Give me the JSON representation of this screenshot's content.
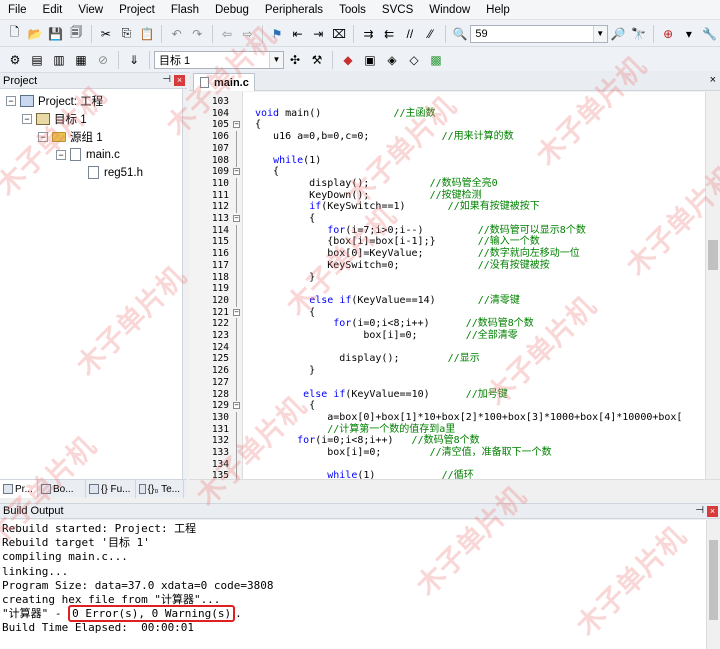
{
  "menu": [
    "File",
    "Edit",
    "View",
    "Project",
    "Flash",
    "Debug",
    "Peripherals",
    "Tools",
    "SVCS",
    "Window",
    "Help"
  ],
  "toolbar": {
    "find_value": "59",
    "target_select": "目标 1",
    "icons": [
      "new-file-icon",
      "open-icon",
      "save-icon",
      "save-all-icon",
      "cut-icon",
      "copy-icon",
      "paste-icon",
      "undo-icon",
      "redo-icon",
      "back-icon",
      "forward-icon",
      "bookmark-icon",
      "find-in-files-icon",
      "indent-icon",
      "unindent-icon",
      "comment-icon",
      "uncomment-icon",
      "find-icon",
      "debug-icon",
      "settings-icon"
    ]
  },
  "project_panel": {
    "title": "Project",
    "tree": [
      {
        "label": "Project: 工程",
        "level": 0,
        "kind": "project",
        "toggle": "−"
      },
      {
        "label": "目标 1",
        "level": 1,
        "kind": "target",
        "toggle": "−"
      },
      {
        "label": "源组 1",
        "level": 2,
        "kind": "folder",
        "toggle": "−"
      },
      {
        "label": "main.c",
        "level": 3,
        "kind": "file",
        "toggle": "−"
      },
      {
        "label": "reg51.h",
        "level": 4,
        "kind": "file",
        "toggle": ""
      }
    ],
    "tabs": [
      "Pr...",
      "Bo...",
      "{} Fu...",
      "{}₀ Te..."
    ]
  },
  "editor": {
    "tab_label": "main.c",
    "lines": [
      {
        "n": "103",
        "t": "",
        "fold": ""
      },
      {
        "n": "104",
        "t": "void main()            //主函数",
        "fold": ""
      },
      {
        "n": "105",
        "t": "{",
        "fold": "−"
      },
      {
        "n": "106",
        "t": "   u16 a=0,b=0,c=0;            //用来计算的数",
        "fold": ""
      },
      {
        "n": "107",
        "t": "",
        "fold": ""
      },
      {
        "n": "108",
        "t": "   while(1)",
        "fold": ""
      },
      {
        "n": "109",
        "t": "   {",
        "fold": "−"
      },
      {
        "n": "110",
        "t": "         display();          //数码管全亮0",
        "fold": ""
      },
      {
        "n": "111",
        "t": "         KeyDown();          //按键检测",
        "fold": ""
      },
      {
        "n": "112",
        "t": "         if(KeySwitch==1)       //如果有按键被按下",
        "fold": ""
      },
      {
        "n": "113",
        "t": "         {",
        "fold": "−"
      },
      {
        "n": "114",
        "t": "            for(i=7;i>0;i--)         //数码管可以显示8个数",
        "fold": ""
      },
      {
        "n": "115",
        "t": "            {box[i]=box[i-1];}       //输入一个数",
        "fold": ""
      },
      {
        "n": "116",
        "t": "            box[0]=KeyValue;         //数字就向左移动一位",
        "fold": ""
      },
      {
        "n": "117",
        "t": "            KeySwitch=0;             //没有按键被按",
        "fold": ""
      },
      {
        "n": "118",
        "t": "         }",
        "fold": ""
      },
      {
        "n": "119",
        "t": "",
        "fold": ""
      },
      {
        "n": "120",
        "t": "         else if(KeyValue==14)       //清零键",
        "fold": ""
      },
      {
        "n": "121",
        "t": "         {",
        "fold": "−"
      },
      {
        "n": "122",
        "t": "             for(i=0;i<8;i++)      //数码管8个数",
        "fold": ""
      },
      {
        "n": "123",
        "t": "                  box[i]=0;        //全部清零",
        "fold": ""
      },
      {
        "n": "124",
        "t": "",
        "fold": ""
      },
      {
        "n": "125",
        "t": "              display();        //显示",
        "fold": ""
      },
      {
        "n": "126",
        "t": "         }",
        "fold": ""
      },
      {
        "n": "127",
        "t": "",
        "fold": ""
      },
      {
        "n": "128",
        "t": "        else if(KeyValue==10)      //加号键",
        "fold": ""
      },
      {
        "n": "129",
        "t": "         {",
        "fold": "−"
      },
      {
        "n": "130",
        "t": "            a=box[0]+box[1]*10+box[2]*100+box[3]*1000+box[4]*10000+box[",
        "fold": ""
      },
      {
        "n": "131",
        "t": "            //计算第一个数的值存到a里",
        "fold": ""
      },
      {
        "n": "132",
        "t": "       for(i=0;i<8;i++)   //数码管8个数",
        "fold": ""
      },
      {
        "n": "133",
        "t": "            box[i]=0;        //清空值，准备取下一个数",
        "fold": ""
      },
      {
        "n": "134",
        "t": "",
        "fold": ""
      },
      {
        "n": "135",
        "t": "            while(1)           //循环",
        "fold": ""
      }
    ]
  },
  "build_output": {
    "title": "Build Output",
    "lines": [
      "Rebuild started: Project: 工程",
      "Rebuild target '目标 1'",
      "compiling main.c...",
      "linking...",
      "Program Size: data=37.0 xdata=0 code=3808",
      "creating hex file from \"计算器\"...",
      "\"计算器\" - ",
      "Build Time Elapsed:  00:00:01"
    ],
    "result_highlight": "0 Error(s), 0 Warning(s)",
    "result_suffix": "."
  },
  "watermark_text": "木子单片机"
}
